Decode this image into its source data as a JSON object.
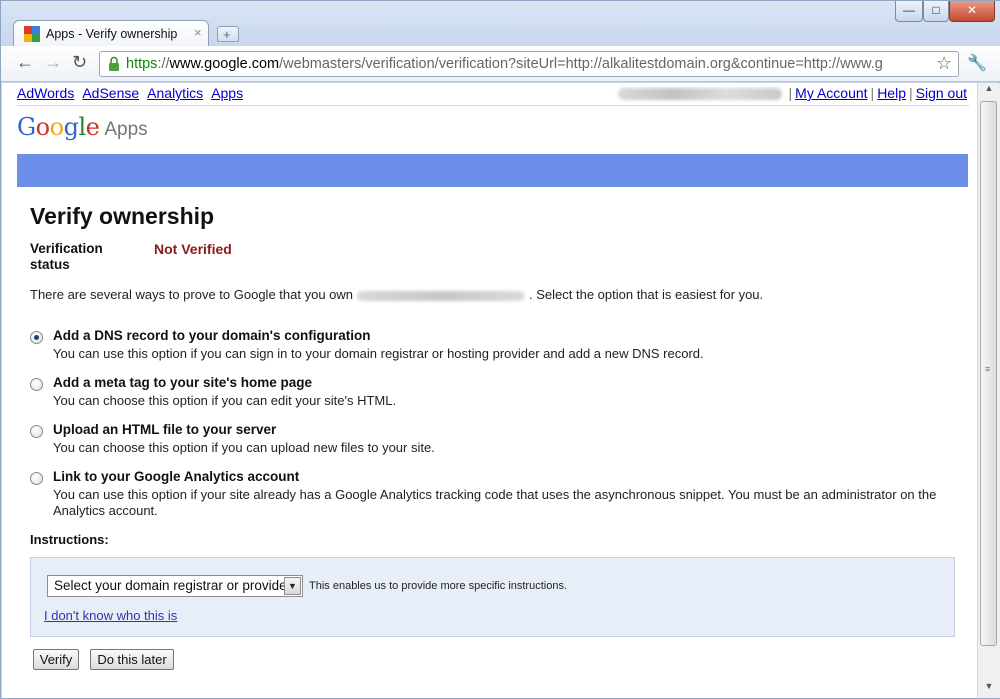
{
  "window": {
    "tab_title": "Apps - Verify ownership",
    "tab_close": "×",
    "new_tab": "+",
    "min": "—",
    "max": "□",
    "close": "✕"
  },
  "toolbar": {
    "url_scheme": "https",
    "url_sep": "://",
    "url_host": "www.google.com",
    "url_rest": "/webmasters/verification/verification?siteUrl=http://alkalitestdomain.org&continue=http://www.g",
    "back": "←",
    "forward": "→",
    "reload": "↻",
    "star": "☆",
    "wrench": "🔧"
  },
  "topnav": {
    "links": [
      "AdWords",
      "AdSense",
      "Analytics",
      "Apps"
    ],
    "my_account": "My Account",
    "help": "Help",
    "sign_out": "Sign out",
    "sep": "|"
  },
  "logo": {
    "letters": [
      "G",
      "o",
      "o",
      "g",
      "l",
      "e"
    ],
    "colors": [
      "#3366cc",
      "#cc3322",
      "#eeaa11",
      "#3366cc",
      "#228833",
      "#cc3322"
    ],
    "suffix": "Apps"
  },
  "page": {
    "title": "Verify ownership",
    "status_label": "Verification status",
    "status_value": "Not Verified",
    "intro_before": "There are several ways to prove to Google that you own",
    "intro_after": ". Select the option that is easiest for you."
  },
  "options": [
    {
      "title": "Add a DNS record to your domain's configuration",
      "desc": "You can use this option if you can sign in to your domain registrar or hosting provider and add a new DNS record.",
      "checked": true
    },
    {
      "title": "Add a meta tag to your site's home page",
      "desc": "You can choose this option if you can edit your site's HTML.",
      "checked": false
    },
    {
      "title": "Upload an HTML file to your server",
      "desc": "You can choose this option if you can upload new files to your site.",
      "checked": false
    },
    {
      "title": "Link to your Google Analytics account",
      "desc": "You can use this option if your site already has a Google Analytics tracking code that uses the asynchronous snippet. You must be an administrator on the Analytics account.",
      "checked": false
    }
  ],
  "instructions": {
    "label": "Instructions:",
    "select_value": "Select your domain registrar or provider",
    "hint": "This enables us to provide more specific instructions.",
    "unknown_link": "I don't know who this is"
  },
  "buttons": {
    "verify": "Verify",
    "later": "Do this later"
  },
  "colors": {
    "blue_bar": "#6d8ee8",
    "not_verified": "#8b1a1a",
    "link": "#0000cc"
  }
}
